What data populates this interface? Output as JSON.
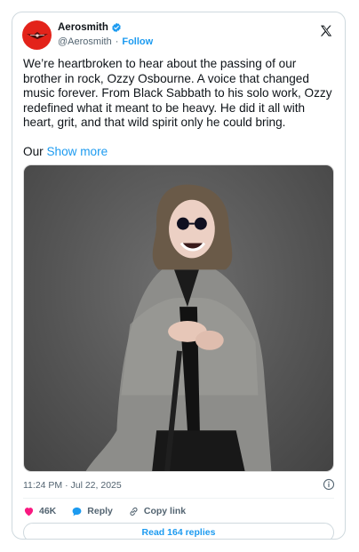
{
  "author": {
    "display_name": "Aerosmith",
    "handle": "@Aerosmith",
    "separator": "·",
    "follow_label": "Follow"
  },
  "tweet": {
    "text": "We’re heartbroken to hear about the passing of our brother in rock, Ozzy Osbourne. A voice that changed music forever. From Black Sabbath to his solo work, Ozzy redefined what it meant to be heavy. He did it all with heart, grit, and that wild spirit only he could bring.",
    "truncated_prefix": "Our ",
    "show_more_label": "Show more"
  },
  "meta": {
    "timestamp": "11:24 PM · Jul 22, 2025"
  },
  "actions": {
    "like_count": "46K",
    "reply_label": "Reply",
    "copy_link_label": "Copy link"
  },
  "replies_button": {
    "label": "Read 164 replies"
  },
  "colors": {
    "accent": "#1d9bf0",
    "like": "#f91880",
    "avatar_bg": "#e3231a"
  },
  "icons": [
    "aerosmith-logo",
    "verified-badge-icon",
    "x-logo-icon",
    "info-icon",
    "heart-icon",
    "reply-bubble-icon",
    "link-icon"
  ]
}
